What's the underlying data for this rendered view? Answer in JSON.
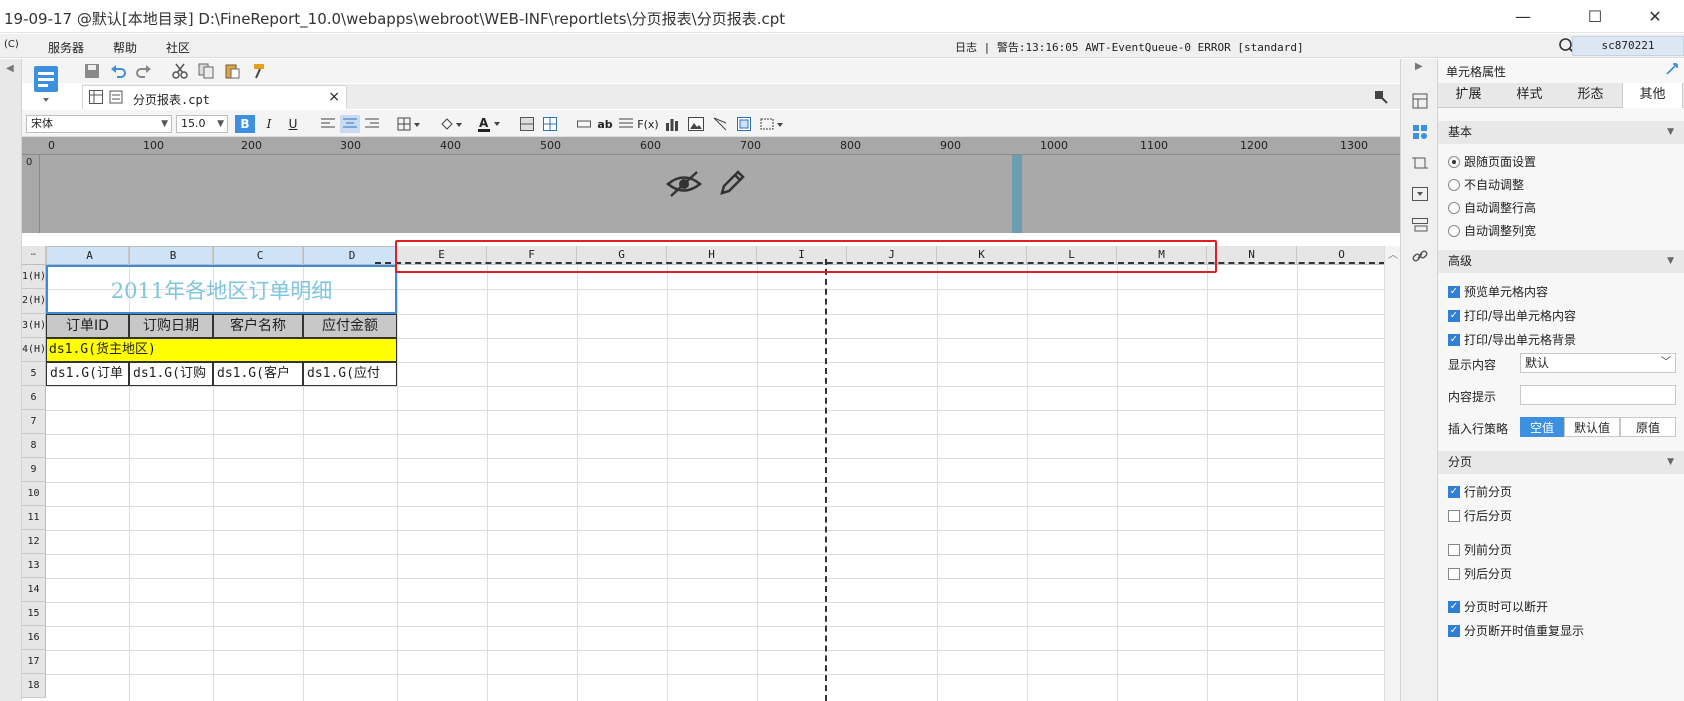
{
  "window": {
    "title": "19-09-17 @默认[本地目录]    D:\\FineReport_10.0\\webapps\\webroot\\WEB-INF\\reportlets\\分页报表\\分页报表.cpt",
    "minimize": "—",
    "maximize": "☐",
    "close": "✕"
  },
  "menubar": {
    "lead": "(C)",
    "items": [
      "服务器",
      "帮助",
      "社区"
    ],
    "status_log": "日志 | 警告:13:16:05 AWT-EventQueue-0 ERROR [standard]",
    "user": "sc870221"
  },
  "tab": {
    "filename": "分页报表.cpt",
    "close": "×"
  },
  "format": {
    "font": "宋体",
    "size": "15.0"
  },
  "ruler": {
    "zero": "0",
    "marks": [
      "0",
      "100",
      "200",
      "300",
      "400",
      "500",
      "600",
      "700",
      "800",
      "900",
      "1000",
      "1100",
      "1200",
      "1300"
    ]
  },
  "grid": {
    "columns": [
      "A",
      "B",
      "C",
      "D",
      "E",
      "F",
      "G",
      "H",
      "I",
      "J",
      "K",
      "L",
      "M",
      "N",
      "O"
    ],
    "rows": [
      "1(H)",
      "2(H)",
      "3(H)",
      "4(H)",
      "5",
      "6",
      "7",
      "8",
      "9",
      "10",
      "11",
      "12",
      "13",
      "14",
      "15",
      "16",
      "17",
      "18"
    ],
    "title_cell": "2011年各地区订单明细",
    "header_cells": [
      "订单ID",
      "订购日期",
      "客户名称",
      "应付金额"
    ],
    "group_cell": "ds1.G(货主地区)",
    "data_cells": [
      "ds1.G(订单",
      "ds1.G(订购",
      "ds1.G(客户",
      "ds1.G(应付"
    ]
  },
  "panel": {
    "title": "单元格属性",
    "tabs": [
      "扩展",
      "样式",
      "形态",
      "其他"
    ],
    "active_tab": "其他",
    "basic": {
      "title": "基本",
      "options": [
        {
          "label": "跟随页面设置",
          "checked": true
        },
        {
          "label": "不自动调整",
          "checked": false
        },
        {
          "label": "自动调整行高",
          "checked": false
        },
        {
          "label": "自动调整列宽",
          "checked": false
        }
      ]
    },
    "advanced": {
      "title": "高级",
      "checks": [
        {
          "label": "预览单元格内容",
          "checked": true
        },
        {
          "label": "打印/导出单元格内容",
          "checked": true
        },
        {
          "label": "打印/导出单元格背景",
          "checked": true
        }
      ],
      "display_label": "显示内容",
      "display_value": "默认",
      "tip_label": "内容提示",
      "tip_value": "",
      "insert_label": "插入行策略",
      "insert_options": [
        "空值",
        "默认值",
        "原值"
      ],
      "insert_active": "空值"
    },
    "paging": {
      "title": "分页",
      "checks": [
        {
          "label": "行前分页",
          "checked": true
        },
        {
          "label": "行后分页",
          "checked": false
        },
        {
          "label": "列前分页",
          "checked": false
        },
        {
          "label": "列后分页",
          "checked": false
        },
        {
          "label": "分页时可以断开",
          "checked": true
        },
        {
          "label": "分页断开时值重复显示",
          "checked": true
        }
      ]
    }
  },
  "colors": {
    "accent": "#3d8fe0",
    "title_text": "#7fc5df",
    "group_fill": "#ffff00",
    "highlight_border": "#e02020"
  }
}
